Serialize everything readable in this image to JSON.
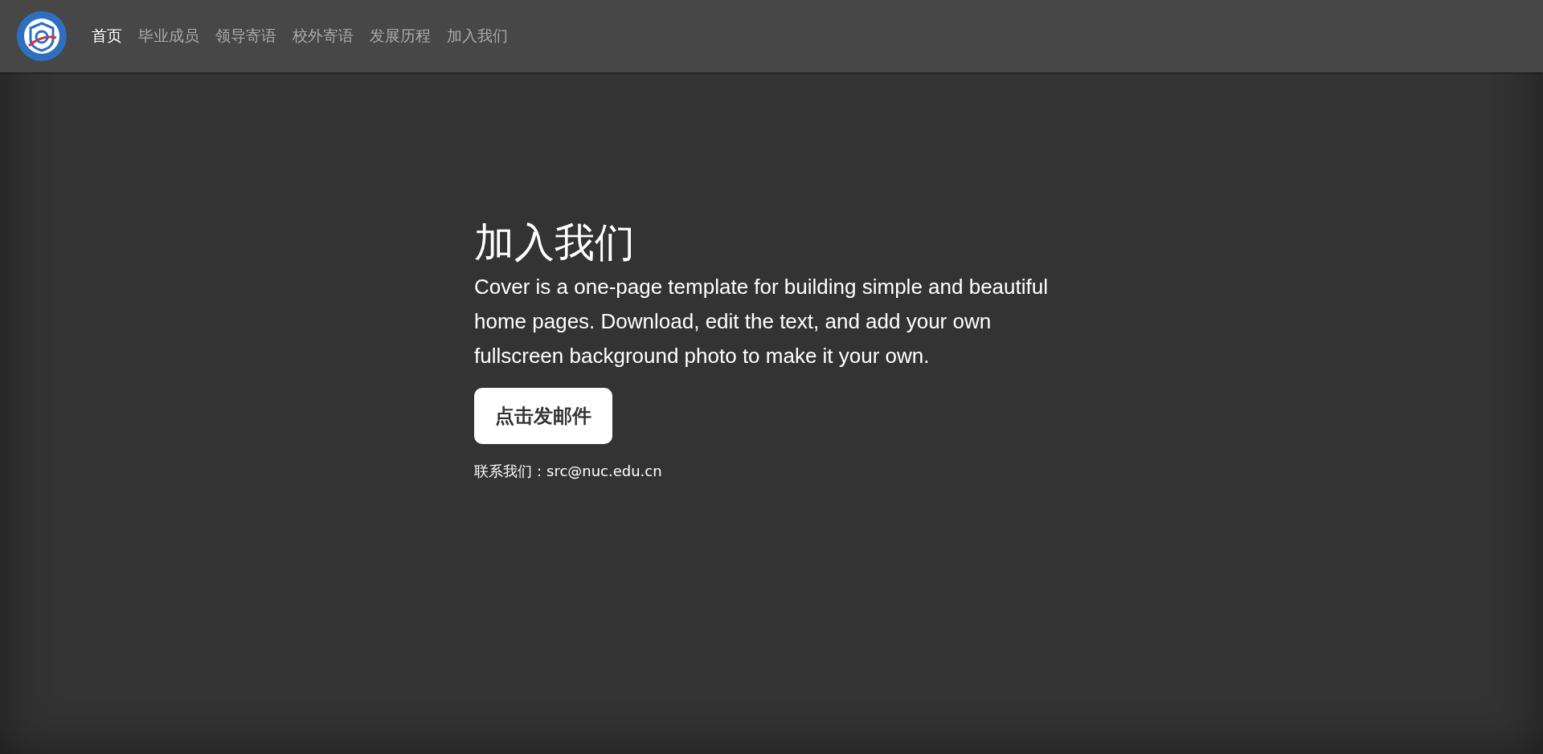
{
  "nav": {
    "items": [
      {
        "label": "首页",
        "selected": true
      },
      {
        "label": "毕业成员",
        "selected": false
      },
      {
        "label": "领导寄语",
        "selected": false
      },
      {
        "label": "校外寄语",
        "selected": false
      },
      {
        "label": "发展历程",
        "selected": false
      },
      {
        "label": "加入我们",
        "selected": false
      }
    ]
  },
  "hero": {
    "title": "加入我们",
    "description": "Cover is a one-page template for building simple and beautiful home pages. Download, edit the text, and add your own fullscreen background photo to make it your own.",
    "button": "点击发邮件",
    "contact": "联系我们：src@nuc.edu.cn"
  }
}
